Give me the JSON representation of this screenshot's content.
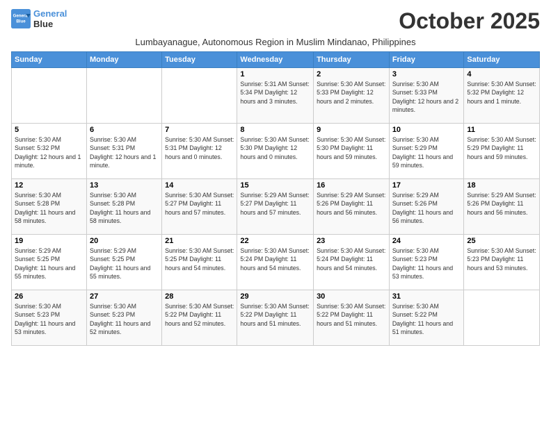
{
  "logo": {
    "line1": "General",
    "line2": "Blue"
  },
  "title": "October 2025",
  "subtitle": "Lumbayanague, Autonomous Region in Muslim Mindanao, Philippines",
  "headers": [
    "Sunday",
    "Monday",
    "Tuesday",
    "Wednesday",
    "Thursday",
    "Friday",
    "Saturday"
  ],
  "weeks": [
    [
      {
        "day": "",
        "info": ""
      },
      {
        "day": "",
        "info": ""
      },
      {
        "day": "",
        "info": ""
      },
      {
        "day": "1",
        "info": "Sunrise: 5:31 AM\nSunset: 5:34 PM\nDaylight: 12 hours and 3 minutes."
      },
      {
        "day": "2",
        "info": "Sunrise: 5:30 AM\nSunset: 5:33 PM\nDaylight: 12 hours and 2 minutes."
      },
      {
        "day": "3",
        "info": "Sunrise: 5:30 AM\nSunset: 5:33 PM\nDaylight: 12 hours and 2 minutes."
      },
      {
        "day": "4",
        "info": "Sunrise: 5:30 AM\nSunset: 5:32 PM\nDaylight: 12 hours and 1 minute."
      }
    ],
    [
      {
        "day": "5",
        "info": "Sunrise: 5:30 AM\nSunset: 5:32 PM\nDaylight: 12 hours and 1 minute."
      },
      {
        "day": "6",
        "info": "Sunrise: 5:30 AM\nSunset: 5:31 PM\nDaylight: 12 hours and 1 minute."
      },
      {
        "day": "7",
        "info": "Sunrise: 5:30 AM\nSunset: 5:31 PM\nDaylight: 12 hours and 0 minutes."
      },
      {
        "day": "8",
        "info": "Sunrise: 5:30 AM\nSunset: 5:30 PM\nDaylight: 12 hours and 0 minutes."
      },
      {
        "day": "9",
        "info": "Sunrise: 5:30 AM\nSunset: 5:30 PM\nDaylight: 11 hours and 59 minutes."
      },
      {
        "day": "10",
        "info": "Sunrise: 5:30 AM\nSunset: 5:29 PM\nDaylight: 11 hours and 59 minutes."
      },
      {
        "day": "11",
        "info": "Sunrise: 5:30 AM\nSunset: 5:29 PM\nDaylight: 11 hours and 59 minutes."
      }
    ],
    [
      {
        "day": "12",
        "info": "Sunrise: 5:30 AM\nSunset: 5:28 PM\nDaylight: 11 hours and 58 minutes."
      },
      {
        "day": "13",
        "info": "Sunrise: 5:30 AM\nSunset: 5:28 PM\nDaylight: 11 hours and 58 minutes."
      },
      {
        "day": "14",
        "info": "Sunrise: 5:30 AM\nSunset: 5:27 PM\nDaylight: 11 hours and 57 minutes."
      },
      {
        "day": "15",
        "info": "Sunrise: 5:29 AM\nSunset: 5:27 PM\nDaylight: 11 hours and 57 minutes."
      },
      {
        "day": "16",
        "info": "Sunrise: 5:29 AM\nSunset: 5:26 PM\nDaylight: 11 hours and 56 minutes."
      },
      {
        "day": "17",
        "info": "Sunrise: 5:29 AM\nSunset: 5:26 PM\nDaylight: 11 hours and 56 minutes."
      },
      {
        "day": "18",
        "info": "Sunrise: 5:29 AM\nSunset: 5:26 PM\nDaylight: 11 hours and 56 minutes."
      }
    ],
    [
      {
        "day": "19",
        "info": "Sunrise: 5:29 AM\nSunset: 5:25 PM\nDaylight: 11 hours and 55 minutes."
      },
      {
        "day": "20",
        "info": "Sunrise: 5:29 AM\nSunset: 5:25 PM\nDaylight: 11 hours and 55 minutes."
      },
      {
        "day": "21",
        "info": "Sunrise: 5:30 AM\nSunset: 5:25 PM\nDaylight: 11 hours and 54 minutes."
      },
      {
        "day": "22",
        "info": "Sunrise: 5:30 AM\nSunset: 5:24 PM\nDaylight: 11 hours and 54 minutes."
      },
      {
        "day": "23",
        "info": "Sunrise: 5:30 AM\nSunset: 5:24 PM\nDaylight: 11 hours and 54 minutes."
      },
      {
        "day": "24",
        "info": "Sunrise: 5:30 AM\nSunset: 5:23 PM\nDaylight: 11 hours and 53 minutes."
      },
      {
        "day": "25",
        "info": "Sunrise: 5:30 AM\nSunset: 5:23 PM\nDaylight: 11 hours and 53 minutes."
      }
    ],
    [
      {
        "day": "26",
        "info": "Sunrise: 5:30 AM\nSunset: 5:23 PM\nDaylight: 11 hours and 53 minutes."
      },
      {
        "day": "27",
        "info": "Sunrise: 5:30 AM\nSunset: 5:23 PM\nDaylight: 11 hours and 52 minutes."
      },
      {
        "day": "28",
        "info": "Sunrise: 5:30 AM\nSunset: 5:22 PM\nDaylight: 11 hours and 52 minutes."
      },
      {
        "day": "29",
        "info": "Sunrise: 5:30 AM\nSunset: 5:22 PM\nDaylight: 11 hours and 51 minutes."
      },
      {
        "day": "30",
        "info": "Sunrise: 5:30 AM\nSunset: 5:22 PM\nDaylight: 11 hours and 51 minutes."
      },
      {
        "day": "31",
        "info": "Sunrise: 5:30 AM\nSunset: 5:22 PM\nDaylight: 11 hours and 51 minutes."
      },
      {
        "day": "",
        "info": ""
      }
    ]
  ]
}
